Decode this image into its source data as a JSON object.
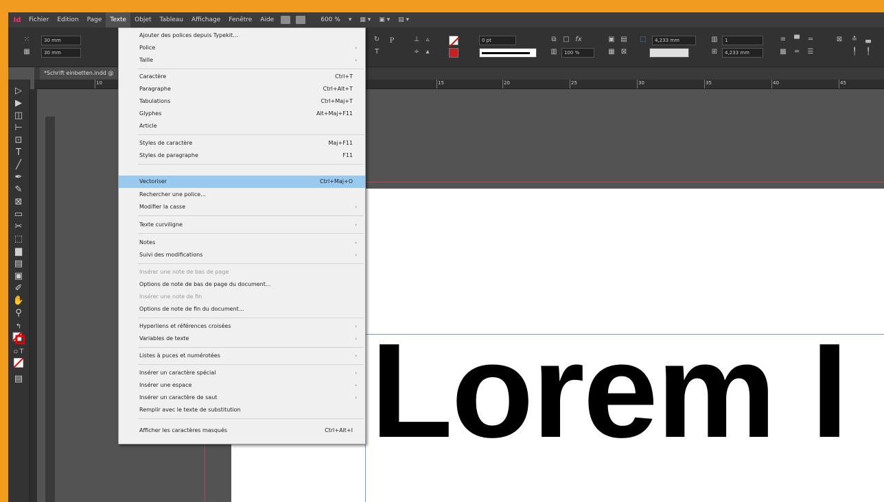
{
  "menubar": {
    "logo": "Id",
    "items": [
      "Fichier",
      "Edition",
      "Page",
      "Texte",
      "Objet",
      "Tableau",
      "Affichage",
      "Fenêtre",
      "Aide"
    ],
    "zoom": "600 %"
  },
  "control": {
    "x_value": "30 mm",
    "y_value": "30 mm",
    "font_size": "0 pt",
    "pct_value": "100 %",
    "dim1": "4,233 mm",
    "dim2": "4,233 mm",
    "cols": "1"
  },
  "document": {
    "tab_title": "*Schrift einbetten.indd @"
  },
  "ruler": {
    "labels": [
      "10",
      "15",
      "20",
      "25",
      "30",
      "35",
      "40",
      "45"
    ]
  },
  "canvas": {
    "text": "Lorem I"
  },
  "menu": {
    "items": [
      {
        "label": "Ajouter des polices depuis Typekit..."
      },
      {
        "label": "Police",
        "sub": "›"
      },
      {
        "label": "Taille",
        "sub": "›"
      },
      {
        "label": "Caractère",
        "shortcut": "Ctrl+T"
      },
      {
        "label": "Paragraphe",
        "shortcut": "Ctrl+Alt+T"
      },
      {
        "label": "Tabulations",
        "shortcut": "Ctrl+Maj+T"
      },
      {
        "label": "Glyphes",
        "shortcut": "Alt+Maj+F11"
      },
      {
        "label": "Article"
      },
      {
        "label": "Styles de caractère",
        "shortcut": "Maj+F11"
      },
      {
        "label": "Styles de paragraphe",
        "shortcut": "F11"
      },
      {
        "label": "Vectoriser",
        "shortcut": "Ctrl+Maj+O"
      },
      {
        "label": "Rechercher une police..."
      },
      {
        "label": "Modifier la casse",
        "sub": "›"
      },
      {
        "label": "Texte curviligne",
        "sub": "›"
      },
      {
        "label": "Notes",
        "sub": "›"
      },
      {
        "label": "Suivi des modifications",
        "sub": "›"
      },
      {
        "label": "Insérer une note de bas de page"
      },
      {
        "label": "Options de note de bas de page du document..."
      },
      {
        "label": "Insérer une note de fin"
      },
      {
        "label": "Options de note de fin du document..."
      },
      {
        "label": "Hyperliens et références croisées",
        "sub": "›"
      },
      {
        "label": "Variables de texte",
        "sub": "›"
      },
      {
        "label": "Listes à puces et numérotées",
        "sub": "›"
      },
      {
        "label": "Insérer un caractère spécial",
        "sub": "›"
      },
      {
        "label": "Insérer une espace",
        "sub": "›"
      },
      {
        "label": "Insérer un caractère de saut",
        "sub": "›"
      },
      {
        "label": "Remplir avec le texte de substitution"
      },
      {
        "label": "Afficher les caractères masqués",
        "shortcut": "Ctrl+Alt+I"
      }
    ]
  }
}
